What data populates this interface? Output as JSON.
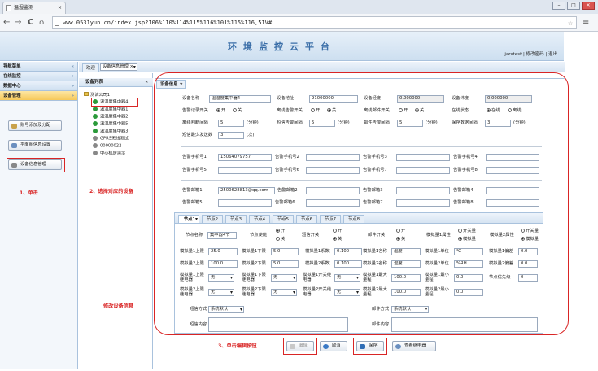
{
  "browser": {
    "tab_title": "温湿监测",
    "close_glyph": "×",
    "url": "www.0531yun.cn/index.jsp?106%110%114%115%116%101%115%116,51V#",
    "back": "←",
    "forward": "→",
    "reload": "C",
    "home": "⌂",
    "star": "☆",
    "menu": "≡",
    "min": "–",
    "max": "□",
    "close": "✕"
  },
  "header": {
    "title": "环境监控云平台",
    "user": "jarxtest",
    "change_pwd": "修改密码",
    "logout": "退出",
    "sep": "|"
  },
  "sidebar": {
    "title": "导航菜单",
    "chev": "«",
    "sections": [
      {
        "label": "在线监控",
        "chev": "»"
      },
      {
        "label": "数据中心",
        "chev": "»"
      },
      {
        "label": "设备管理",
        "chev": "»"
      }
    ],
    "buttons": [
      "账号添加及分配",
      "平面图信息设置",
      "设备信息管理"
    ]
  },
  "top_tabs": [
    "欢迎",
    "设备信息管理 ×"
  ],
  "tree": {
    "title": "设备列表",
    "collapse": "«",
    "root": "测试公司1",
    "nodes": [
      "温湿度集中器4",
      "温湿度集中器1",
      "温湿度集中器2",
      "温湿度集中器5",
      "温湿度集中器3",
      "GPRS无线测试",
      "00000022",
      "中心机房演示"
    ]
  },
  "panel_tab": "设备信息 ×",
  "form": {
    "row1": {
      "name_label": "设备名称",
      "name": "温湿度集中器4",
      "addr_label": "设备地址",
      "addr": "91000000",
      "lng_label": "设备经度",
      "lng": "0.000000",
      "lat_label": "设备纬度",
      "lat": "0.000000"
    },
    "row2": {
      "alarm_rec": "告警记录开关",
      "rx_alarm": "离线告警开关",
      "mail_alarm": "离线邮件开关",
      "online": "在线状态",
      "on": "开",
      "off": "关",
      "online_opt": "在线",
      "offline_opt": "离线"
    },
    "row3": {
      "offline_interval": "离线判断间隔",
      "offline_v": "5",
      "alarm_interval": "短信告警间隔",
      "alarm_v": "5",
      "mail_interval": "邮件告警间隔",
      "mail_v": "5",
      "save_interval": "保存数据间隔",
      "save_v": "3",
      "unit": "(分钟)"
    },
    "row4": {
      "label": "短信最少发送数",
      "value": "3",
      "unit": "(次)"
    },
    "phones": {
      "labels": [
        "告警手机号1",
        "告警手机号2",
        "告警手机号3",
        "告警手机号4",
        "告警手机号5",
        "告警手机号6",
        "告警手机号7",
        "告警手机号8"
      ],
      "phone1": "15064079757"
    },
    "emails": {
      "labels": [
        "告警邮箱1",
        "告警邮箱2",
        "告警邮箱3",
        "告警邮箱4",
        "告警邮箱5",
        "告警邮箱6",
        "告警邮箱7",
        "告警邮箱8"
      ],
      "email1": "2500628813@qq.com"
    }
  },
  "node_tabs": [
    "节点1",
    "节点2",
    "节点3",
    "节点4",
    "节点5",
    "节点6",
    "节点7",
    "节点8"
  ],
  "node": {
    "name_label": "节点名称",
    "name": "集中器4节",
    "enable": "节点使能",
    "sms_sw": "短信开关",
    "mail_sw": "邮件开关",
    "attr1": "模拟量1属性",
    "attr2": "模拟量2属性",
    "switch": "开关量",
    "analog": "模拟量",
    "row_a": {
      "u1": "模拟量1上限",
      "u1v": "25.0",
      "l1": "模拟量1下限",
      "l1v": "5.0",
      "c1": "模拟量1系数",
      "c1v": "0.100",
      "n1": "模拟量1名称",
      "n1v": "温度",
      "unit1": "模拟量1单位",
      "unit1v": "℃",
      "d1": "模拟量1偏差",
      "d1v": "0.0"
    },
    "row_b": {
      "u2": "模拟量2上限",
      "u2v": "100.0",
      "l2": "模拟量2下限",
      "l2v": "5.0",
      "c2": "模拟量2系数",
      "c2v": "0.100",
      "n2": "模拟量2名称",
      "n2v": "湿度",
      "unit2": "模拟量2单位",
      "unit2v": "%RH",
      "d2": "模拟量2偏差",
      "d2v": "0.0"
    },
    "row_c": {
      "r1": "模拟量1上限继电器",
      "r2": "模拟量1下限继电器",
      "r3": "模拟量1开关继电器",
      "max1": "模拟量1最大量程",
      "max1v": "100.0",
      "min1": "模拟量1最小量程",
      "min1v": "0.0",
      "prio": "节点优先级",
      "prio_v": "0",
      "none": "无"
    },
    "row_d": {
      "r1": "模拟量2上限继电器",
      "r2": "模拟量2下限继电器",
      "r3": "模拟量2开关继电器",
      "max2": "模拟量2最大量程",
      "max2v": "100.0",
      "min2": "模拟量2最小量程",
      "min2v": "0.0",
      "none": "无"
    },
    "sms_mode": "短信方式",
    "sms_mode_v": "系统默认",
    "mail_mode": "邮件方式",
    "mail_mode_v": "系统默认",
    "sms_content": "短信内容",
    "mail_content": "邮件内容"
  },
  "actions": {
    "edit": "编辑",
    "cancel": "取消",
    "save": "保存",
    "relay": "查看继电器"
  },
  "annotations": {
    "step1": "1、单击",
    "step2": "2、选择对应的设备",
    "step3": "3、单击编辑按钮",
    "modify": "修改设备信息"
  },
  "colors": {
    "red": "#d92525",
    "accent": "#3a6ea8"
  }
}
